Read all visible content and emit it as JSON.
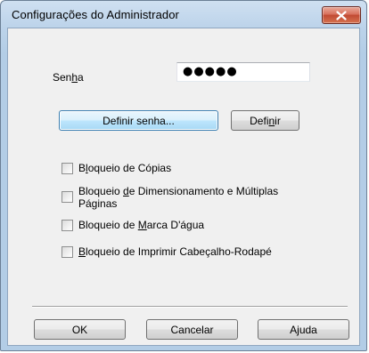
{
  "window": {
    "title": "Configurações do Administrador",
    "close_icon": "close-icon"
  },
  "password": {
    "label_pre": "Sen",
    "label_key": "h",
    "label_post": "a",
    "value": "●●●●●"
  },
  "buttons": {
    "set_password": "Definir senha...",
    "set_pre": "Defi",
    "set_key": "n",
    "set_post": "ir",
    "ok": "OK",
    "cancel": "Cancelar",
    "help_pre": "A",
    "help_key": "j",
    "help_post": "uda"
  },
  "options": [
    {
      "pre": "B",
      "key": "l",
      "post": "oqueio de Cópias",
      "checked": false
    },
    {
      "pre": "Bloqueio ",
      "key": "d",
      "post": "e Dimensionamento e Múltiplas Páginas",
      "checked": false
    },
    {
      "pre": "Bloqueio de ",
      "key": "M",
      "post": "arca D'água",
      "checked": false
    },
    {
      "pre": "",
      "key": "B",
      "post": "loqueio de Imprimir Cabeçalho-Rodapé",
      "checked": false
    }
  ],
  "colors": {
    "titlebar": "#bcd3ea",
    "client": "#f0f0f0",
    "close": "#c14a33",
    "default_button": "#bee6fd"
  }
}
